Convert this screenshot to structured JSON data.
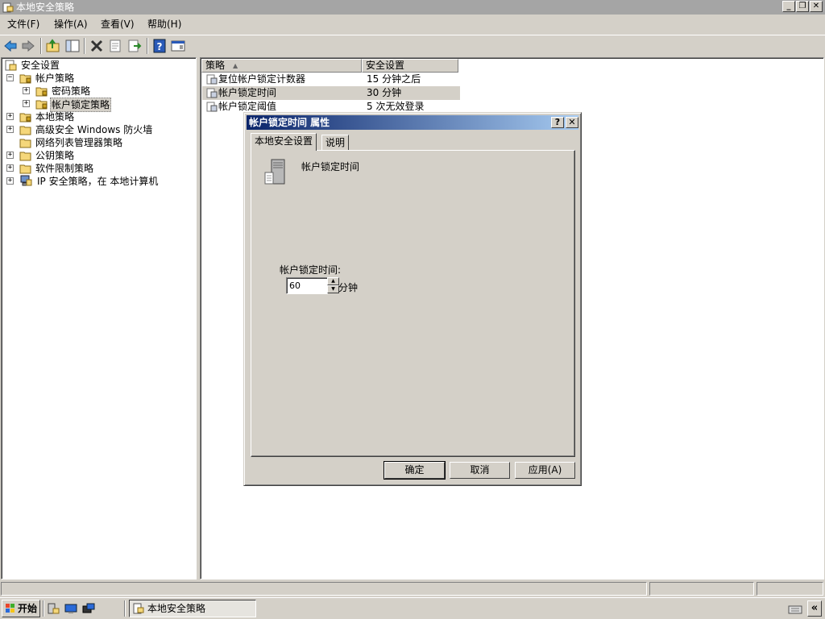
{
  "window": {
    "title": "本地安全策略"
  },
  "menu": [
    {
      "label": "文件(F)"
    },
    {
      "label": "操作(A)"
    },
    {
      "label": "查看(V)"
    },
    {
      "label": "帮助(H)"
    }
  ],
  "tree": {
    "root": "安全设置",
    "account_policies": "帐户策略",
    "password_policy": "密码策略",
    "lockout_policy": "帐户锁定策略",
    "local_policies": "本地策略",
    "firewall": "高级安全 Windows 防火墙",
    "network_list": "网络列表管理器策略",
    "public_key": "公钥策略",
    "software_restriction": "软件限制策略",
    "ipsec": "IP 安全策略，在 本地计算机"
  },
  "list": {
    "col_policy": "策略",
    "col_setting": "安全设置",
    "rows": [
      {
        "policy": "复位帐户锁定计数器",
        "setting": "15 分钟之后"
      },
      {
        "policy": "帐户锁定时间",
        "setting": "30 分钟"
      },
      {
        "policy": "帐户锁定阈值",
        "setting": "5 次无效登录"
      }
    ]
  },
  "dialog": {
    "title": "帐户锁定时间 属性",
    "help_glyph": "?",
    "close_glyph": "✕",
    "tab_local": "本地安全设置",
    "tab_explain": "说明",
    "policy_name": "帐户锁定时间",
    "field_label": "帐户锁定时间:",
    "field_value": "60",
    "unit": "分钟",
    "ok": "确定",
    "cancel": "取消",
    "apply": "应用(A)"
  },
  "taskbar": {
    "start": "开始",
    "task": "本地安全策略",
    "chevron": "«"
  },
  "icons": {
    "folder_color": "#f5d77a",
    "title_gradient_start": "#0a246a",
    "title_gradient_end": "#a6caf0"
  }
}
